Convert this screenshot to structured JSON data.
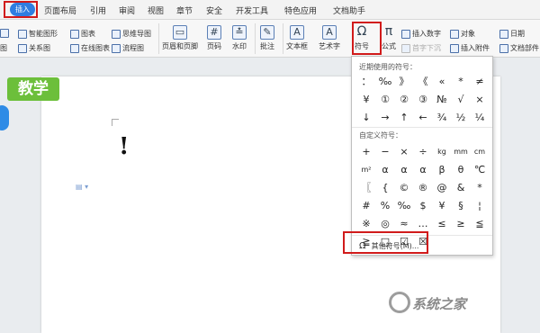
{
  "menu": {
    "tabs": [
      "插入",
      "页面布局",
      "引用",
      "审阅",
      "视图",
      "章节",
      "安全",
      "开发工具",
      "特色应用",
      "文档助手"
    ],
    "active": "插入"
  },
  "ribbon": {
    "smart_shape": "智能图形",
    "chart": "图表",
    "mind_map": "思维导图",
    "relation": "关系图",
    "online_chart": "在线图表",
    "flowchart": "流程图",
    "header_footer": "页眉和页脚",
    "page_num": "页码",
    "watermark": "水印",
    "comment": "批注",
    "textbox": "文本框",
    "art_text": "艺术字",
    "symbol": "符号",
    "formula": "公式",
    "insert_number": "插入数字",
    "object": "对象",
    "date": "日期",
    "drop_cap": "首字下沉",
    "attachment": "插入附件",
    "doc_parts": "文档部件",
    "left_cut": "图"
  },
  "document": {
    "badge": "教学",
    "content": "!"
  },
  "symbol_menu": {
    "recent_title": "近期使用的符号：",
    "recent": [
      "：",
      "‰",
      "》",
      "《",
      "«",
      "*",
      "≠",
      "¥",
      "①",
      "②",
      "③",
      "№",
      "√",
      "×",
      "↓",
      "→",
      "↑",
      "←",
      "¾",
      "½",
      "¼"
    ],
    "custom_title": "自定义符号：",
    "custom": [
      "+",
      "−",
      "×",
      "÷",
      "kg",
      "mm",
      "cm",
      "m²",
      "α",
      "α",
      "α",
      "β",
      "θ",
      "℃",
      "〖",
      "{",
      "©",
      "®",
      "@",
      "&",
      "*",
      "#",
      "%",
      "‰",
      "$",
      "¥",
      "§",
      "¦",
      "※",
      "◎",
      "≈",
      "…",
      "≤",
      "≥",
      "≦",
      "≧",
      "□",
      "☑",
      "☒"
    ],
    "more": "其他符号(M)..."
  },
  "watermark_site": "系统之家"
}
